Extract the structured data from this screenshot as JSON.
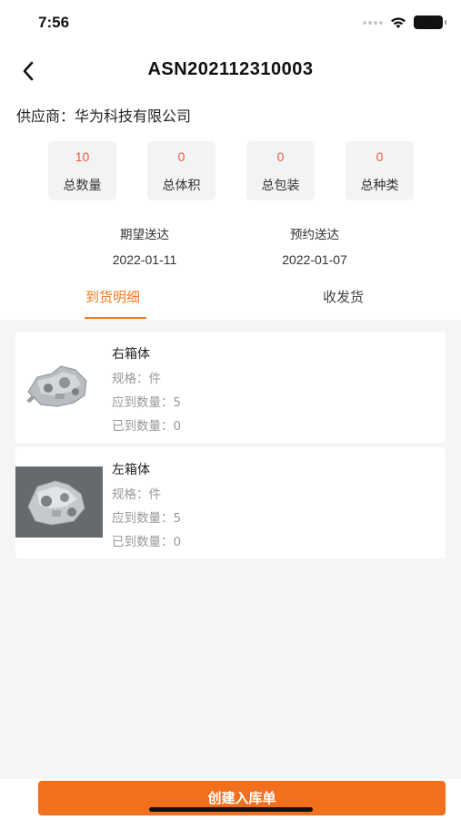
{
  "status_bar": {
    "time": "7:56"
  },
  "nav": {
    "title": "ASN202112310003",
    "back_icon": "chevron-left-icon"
  },
  "supplier": {
    "text": "供应商：华为科技有限公司"
  },
  "stats": [
    {
      "value": "10",
      "label": "总数量"
    },
    {
      "value": "0",
      "label": "总体积"
    },
    {
      "value": "0",
      "label": "总包装"
    },
    {
      "value": "0",
      "label": "总种类"
    }
  ],
  "dates": {
    "expected": {
      "label": "期望送达",
      "value": "2022-01-11"
    },
    "scheduled": {
      "label": "预约送达",
      "value": "2022-01-07"
    }
  },
  "tabs": [
    {
      "label": "到货明细",
      "active": true
    },
    {
      "label": "收发货",
      "active": false
    }
  ],
  "items": [
    {
      "name": "右箱体",
      "spec": "规格：件",
      "expected_qty": "应到数量：5",
      "arrived_qty": "已到数量：0"
    },
    {
      "name": "左箱体",
      "spec": "规格：件",
      "expected_qty": "应到数量：5",
      "arrived_qty": "已到数量：0"
    }
  ],
  "action": {
    "create_label": "创建入库单"
  },
  "colors": {
    "accent": "#f47a20",
    "button": "#f26f1d",
    "stat_value": "#f05a3c",
    "content_bg": "#f5f5f5"
  }
}
